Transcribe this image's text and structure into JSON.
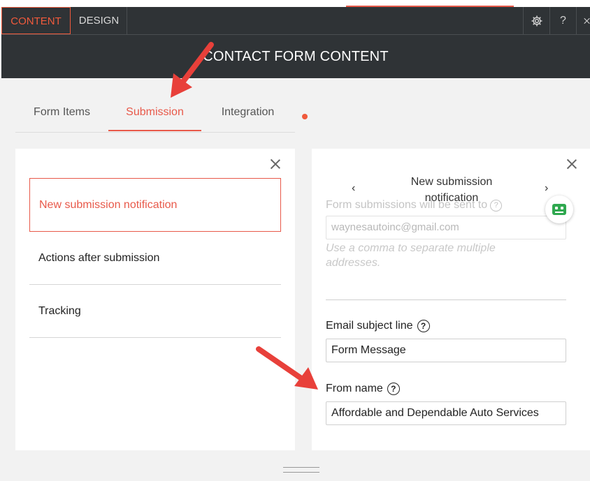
{
  "topbar": {
    "tab_content": "CONTENT",
    "tab_design": "DESIGN",
    "help_label": "?"
  },
  "header": {
    "title": "CONTACT FORM CONTENT"
  },
  "subtabs": {
    "items": [
      "Form Items",
      "Submission",
      "Integration"
    ],
    "active": "Submission"
  },
  "left_panel": {
    "items": [
      "New submission notification",
      "Actions after submission",
      "Tracking"
    ],
    "active": "New submission notification"
  },
  "right_panel": {
    "title": "New submission notification",
    "prev_icon": "chevron-left-icon",
    "next_icon": "chevron-right-icon",
    "recipients_label": "Form submissions will be sent to",
    "recipients_value": "waynesautoinc@gmail.com",
    "recipients_hint": "Use a comma to separate multiple addresses.",
    "subject_label": "Email subject line",
    "subject_value": "Form Message",
    "from_label": "From name",
    "from_value": "Affordable and Dependable Auto Services",
    "help_glyph": "?"
  },
  "colors": {
    "accent": "#e8594a",
    "header_bg": "#2f3336",
    "panel_bg": "#ffffff",
    "page_bg": "#f2f2f2",
    "annotation_arrow": "#e8403a",
    "bot_badge": "#2fa84f"
  }
}
